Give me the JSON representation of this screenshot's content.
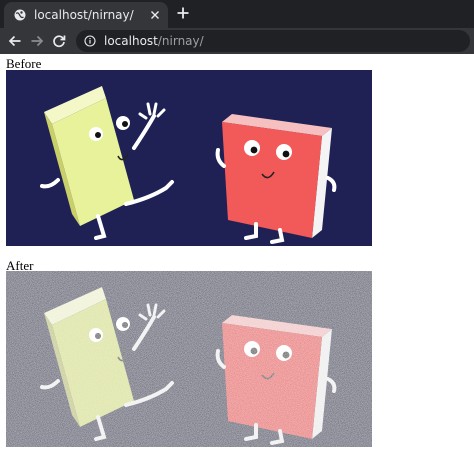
{
  "browser": {
    "tab": {
      "title": "localhost/nirnay/",
      "favicon": "globe-icon",
      "close_icon": "close-icon"
    },
    "new_tab_icon": "plus-icon",
    "toolbar": {
      "back_icon": "arrow-left-icon",
      "forward_icon": "arrow-right-icon",
      "reload_icon": "reload-icon",
      "site_info_icon": "info-icon",
      "url_host": "localhost",
      "url_path": "/nirnay/"
    }
  },
  "page": {
    "before_label": "Before",
    "after_label": "After",
    "colors": {
      "background": "#1f2155",
      "background_noisy": "#2c2e55",
      "yellow_book": "#e8f29a",
      "red_book": "#f25a5a"
    }
  }
}
